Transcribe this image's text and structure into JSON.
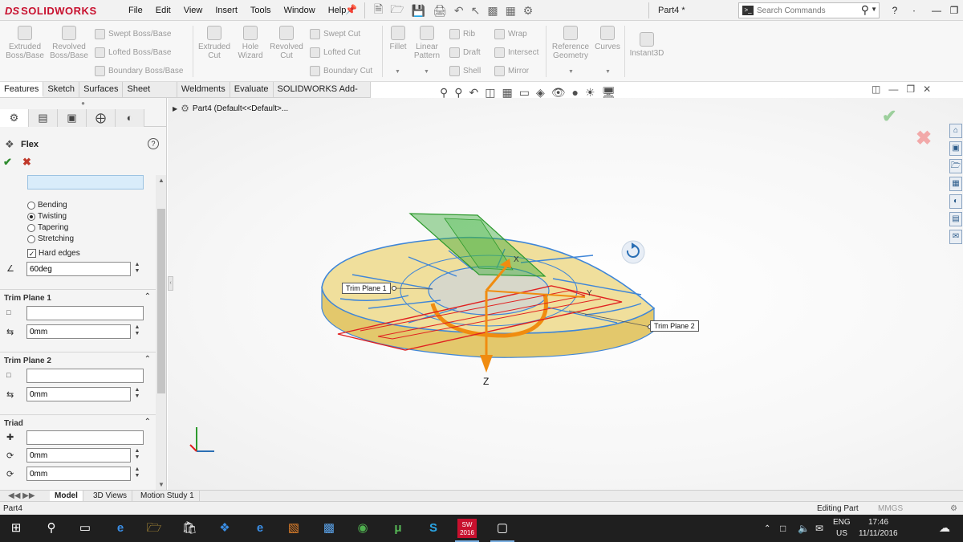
{
  "app": {
    "logo_prefix": "DS",
    "logo_name": "SOLIDWORKS",
    "menus": [
      "File",
      "Edit",
      "View",
      "Insert",
      "Tools",
      "Window",
      "Help"
    ],
    "doc_title": "Part4 *",
    "search_placeholder": "Search Commands"
  },
  "ribbon": {
    "extruded_boss": "Extruded\nBoss/Base",
    "revolved_boss": "Revolved\nBoss/Base",
    "swept_boss": "Swept Boss/Base",
    "lofted_boss": "Lofted Boss/Base",
    "boundary_boss": "Boundary Boss/Base",
    "extruded_cut": "Extruded\nCut",
    "hole_wizard": "Hole\nWizard",
    "revolved_cut": "Revolved\nCut",
    "swept_cut": "Swept Cut",
    "lofted_cut": "Lofted Cut",
    "boundary_cut": "Boundary Cut",
    "fillet": "Fillet",
    "linear_pattern": "Linear\nPattern",
    "rib": "Rib",
    "draft": "Draft",
    "shell": "Shell",
    "wrap": "Wrap",
    "intersect": "Intersect",
    "mirror": "Mirror",
    "reference_geometry": "Reference\nGeometry",
    "curves": "Curves",
    "instant3d": "Instant3D"
  },
  "tabs": [
    "Features",
    "Sketch",
    "Surfaces",
    "Sheet Metal",
    "Weldments",
    "Evaluate",
    "SOLIDWORKS Add-Ins"
  ],
  "tree_path": "Part4  (Default<<Default>...",
  "pm": {
    "title": "Flex",
    "options": [
      {
        "label": "Bending",
        "selected": false
      },
      {
        "label": "Twisting",
        "selected": true
      },
      {
        "label": "Tapering",
        "selected": false
      },
      {
        "label": "Stretching",
        "selected": false
      }
    ],
    "hard_edges_label": "Hard edges",
    "hard_edges_checked": true,
    "angle": "60deg",
    "trim_plane_1": {
      "title": "Trim Plane 1",
      "offset": "0mm"
    },
    "trim_plane_2": {
      "title": "Trim Plane 2",
      "offset": "0mm"
    },
    "triad": {
      "title": "Triad",
      "x": "0mm",
      "y": "0mm"
    }
  },
  "callouts": {
    "trim1": "Trim Plane 1",
    "trim2": "Trim Plane 2",
    "axis_z": "Z",
    "axis_x": "X",
    "axis_y": "Y"
  },
  "bottom_tabs": [
    "Model",
    "3D Views",
    "Motion Study 1"
  ],
  "status": {
    "left": "Part4",
    "mode": "Editing Part",
    "units": "MMGS"
  },
  "taskbar": {
    "lang_top": "ENG",
    "lang_bottom": "US",
    "time": "17:46",
    "date": "11/11/2016",
    "sw_badge": "2016"
  },
  "colors": {
    "model_fill": "#e8d37a",
    "model_edge": "#3f86d8",
    "plane1": "#2e9a2e",
    "plane2": "#e02020",
    "axis_arrow": "#f08c10"
  }
}
